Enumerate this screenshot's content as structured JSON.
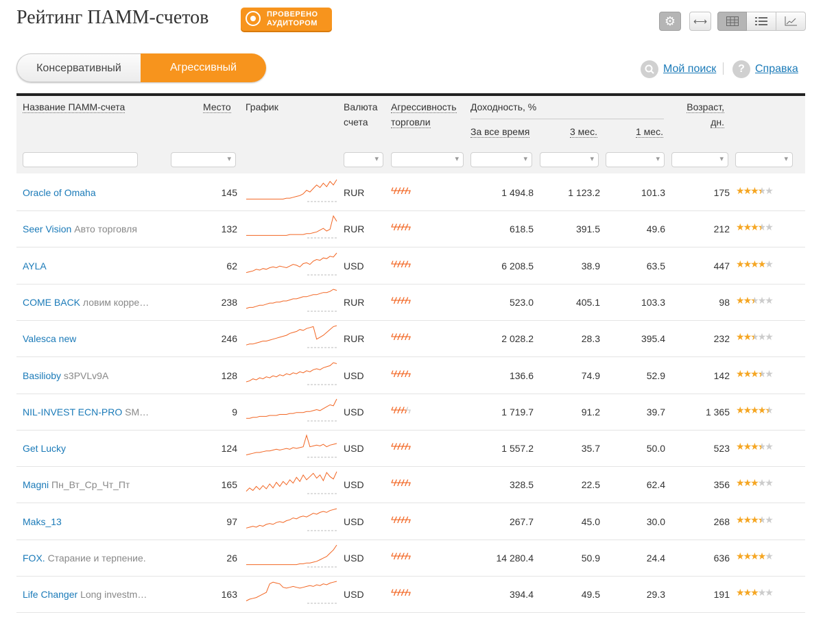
{
  "header": {
    "title": "Рейтинг ПАММ-счетов",
    "badge_line1": "Проверено",
    "badge_line2": "аудитором",
    "settings_icon": "gear-icon",
    "expand_icon": "arrows-horizontal-icon",
    "views": [
      "grid-icon",
      "list-icon",
      "chart-icon"
    ]
  },
  "mode": {
    "conservative": "Консервативный",
    "aggressive": "Агрессивный",
    "active": "aggressive"
  },
  "links": {
    "my_search": "Мой поиск",
    "help": "Справка",
    "help_icon_text": "?"
  },
  "colors": {
    "accent": "#f7941d",
    "link": "#1a7ab8",
    "spark": "#f26522",
    "star": "#f5a623"
  },
  "columns": {
    "name": "Название ПАММ-счета",
    "place": "Место",
    "chart": "График",
    "currency_1": "Валюта",
    "currency_2": "счета",
    "aggr_1": "Агрессивность",
    "aggr_2": "торговли",
    "yield": "Доходность, %",
    "all_time": "За все время",
    "m3": "3 мес.",
    "m1": "1 мес.",
    "age_1": "Возраст,",
    "age_2": "дн."
  },
  "rows": [
    {
      "name": "Oracle of Omaha",
      "sub": "",
      "place": "145",
      "currency": "RUR",
      "aggr": 5,
      "all": "1 494.8",
      "m3": "1 123.2",
      "m1": "101.3",
      "age": "175",
      "rating": 3.5,
      "spark": [
        2,
        2,
        2,
        2,
        2,
        2,
        2,
        2,
        2,
        2,
        2,
        2,
        3,
        3,
        4,
        5,
        6,
        8,
        12,
        10,
        14,
        18,
        15,
        20,
        16,
        22,
        18,
        24
      ]
    },
    {
      "name": "Seer Vision",
      "sub": "Авто торговля",
      "place": "132",
      "currency": "RUR",
      "aggr": 5,
      "all": "618.5",
      "m3": "391.5",
      "m1": "49.6",
      "age": "212",
      "rating": 3.5,
      "spark": [
        2,
        2,
        2,
        2,
        2,
        2,
        2,
        2,
        2,
        2,
        2,
        2,
        2,
        3,
        3,
        3,
        3,
        3,
        4,
        4,
        5,
        6,
        8,
        10,
        7,
        9,
        24,
        18
      ]
    },
    {
      "name": "AYLA",
      "sub": "",
      "place": "62",
      "currency": "USD",
      "aggr": 5,
      "all": "6 208.5",
      "m3": "38.9",
      "m1": "63.5",
      "age": "447",
      "rating": 4,
      "spark": [
        2,
        3,
        4,
        6,
        5,
        7,
        6,
        8,
        9,
        8,
        10,
        9,
        8,
        10,
        12,
        11,
        9,
        13,
        14,
        12,
        16,
        18,
        17,
        20,
        19,
        22,
        21,
        26
      ]
    },
    {
      "name": "COME BACK",
      "sub": "ловим корре…",
      "place": "238",
      "currency": "RUR",
      "aggr": 5,
      "all": "523.0",
      "m3": "405.1",
      "m1": "103.3",
      "age": "98",
      "rating": 2.5,
      "spark": [
        2,
        3,
        3,
        4,
        5,
        5,
        6,
        7,
        7,
        8,
        8,
        9,
        9,
        10,
        11,
        11,
        12,
        13,
        13,
        14,
        15,
        15,
        16,
        17,
        17,
        18,
        20,
        19
      ]
    },
    {
      "name": "Valesca new",
      "sub": "",
      "place": "246",
      "currency": "RUR",
      "aggr": 5,
      "all": "2 028.2",
      "m3": "28.3",
      "m1": "395.4",
      "age": "232",
      "rating": 2.5,
      "spark": [
        2,
        3,
        3,
        4,
        5,
        6,
        6,
        7,
        8,
        9,
        10,
        11,
        12,
        14,
        15,
        16,
        18,
        17,
        19,
        20,
        21,
        8,
        10,
        12,
        15,
        18,
        21,
        22
      ]
    },
    {
      "name": "Basilioby",
      "sub": "s3PVLv9A",
      "place": "128",
      "currency": "USD",
      "aggr": 5,
      "all": "136.6",
      "m3": "74.9",
      "m1": "52.9",
      "age": "142",
      "rating": 3.5,
      "spark": [
        2,
        3,
        5,
        4,
        6,
        5,
        7,
        6,
        8,
        7,
        9,
        8,
        10,
        9,
        11,
        10,
        12,
        11,
        13,
        12,
        14,
        15,
        14,
        16,
        17,
        18,
        21,
        20
      ]
    },
    {
      "name": "NIL-INVEST ECN-PRO",
      "sub": "SM…",
      "place": "9",
      "currency": "USD",
      "aggr": 4,
      "all": "1 719.7",
      "m3": "91.2",
      "m1": "39.7",
      "age": "1 365",
      "rating": 4.5,
      "spark": [
        2,
        2,
        3,
        3,
        4,
        4,
        4,
        5,
        5,
        5,
        6,
        6,
        6,
        7,
        7,
        8,
        8,
        8,
        9,
        9,
        10,
        11,
        10,
        12,
        14,
        16,
        15,
        22
      ]
    },
    {
      "name": "Get Lucky",
      "sub": "",
      "place": "124",
      "currency": "USD",
      "aggr": 5,
      "all": "1 557.2",
      "m3": "35.7",
      "m1": "50.0",
      "age": "523",
      "rating": 3.5,
      "spark": [
        2,
        3,
        4,
        5,
        5,
        6,
        7,
        7,
        8,
        9,
        8,
        9,
        10,
        9,
        11,
        10,
        11,
        12,
        26,
        12,
        13,
        14,
        13,
        15,
        12,
        14,
        15,
        16
      ]
    },
    {
      "name": "Magni",
      "sub": "Пн_Вт_Ср_Чт_Пт",
      "place": "165",
      "currency": "USD",
      "aggr": 5,
      "all": "328.5",
      "m3": "22.5",
      "m1": "62.4",
      "age": "356",
      "rating": 3,
      "spark": [
        2,
        6,
        3,
        8,
        4,
        9,
        5,
        11,
        6,
        13,
        8,
        14,
        10,
        16,
        12,
        19,
        14,
        22,
        16,
        20,
        24,
        18,
        22,
        15,
        25,
        20,
        17,
        26
      ]
    },
    {
      "name": "Maks_13",
      "sub": "",
      "place": "97",
      "currency": "USD",
      "aggr": 5,
      "all": "267.7",
      "m3": "45.0",
      "m1": "30.0",
      "age": "268",
      "rating": 3.5,
      "spark": [
        2,
        3,
        4,
        3,
        5,
        4,
        6,
        7,
        6,
        8,
        9,
        8,
        10,
        11,
        13,
        12,
        14,
        15,
        14,
        16,
        18,
        17,
        19,
        20,
        19,
        21,
        22,
        23
      ]
    },
    {
      "name": "FOX.",
      "sub": "Старание и терпение.",
      "place": "26",
      "currency": "USD",
      "aggr": 5,
      "all": "14 280.4",
      "m3": "50.9",
      "m1": "24.4",
      "age": "636",
      "rating": 4,
      "spark": [
        2,
        2,
        2,
        2,
        2,
        2,
        2,
        2,
        2,
        2,
        2,
        2,
        2,
        2,
        2,
        2,
        3,
        3,
        4,
        4,
        5,
        6,
        8,
        10,
        12,
        16,
        20,
        26
      ]
    },
    {
      "name": "Life Changer",
      "sub": "Long investm…",
      "place": "163",
      "currency": "USD",
      "aggr": 5,
      "all": "394.4",
      "m3": "49.5",
      "m1": "29.3",
      "age": "191",
      "rating": 3,
      "spark": [
        2,
        4,
        5,
        6,
        8,
        10,
        12,
        22,
        24,
        23,
        22,
        18,
        17,
        18,
        19,
        18,
        17,
        18,
        19,
        20,
        19,
        21,
        20,
        22,
        21,
        23,
        24,
        25
      ]
    }
  ]
}
